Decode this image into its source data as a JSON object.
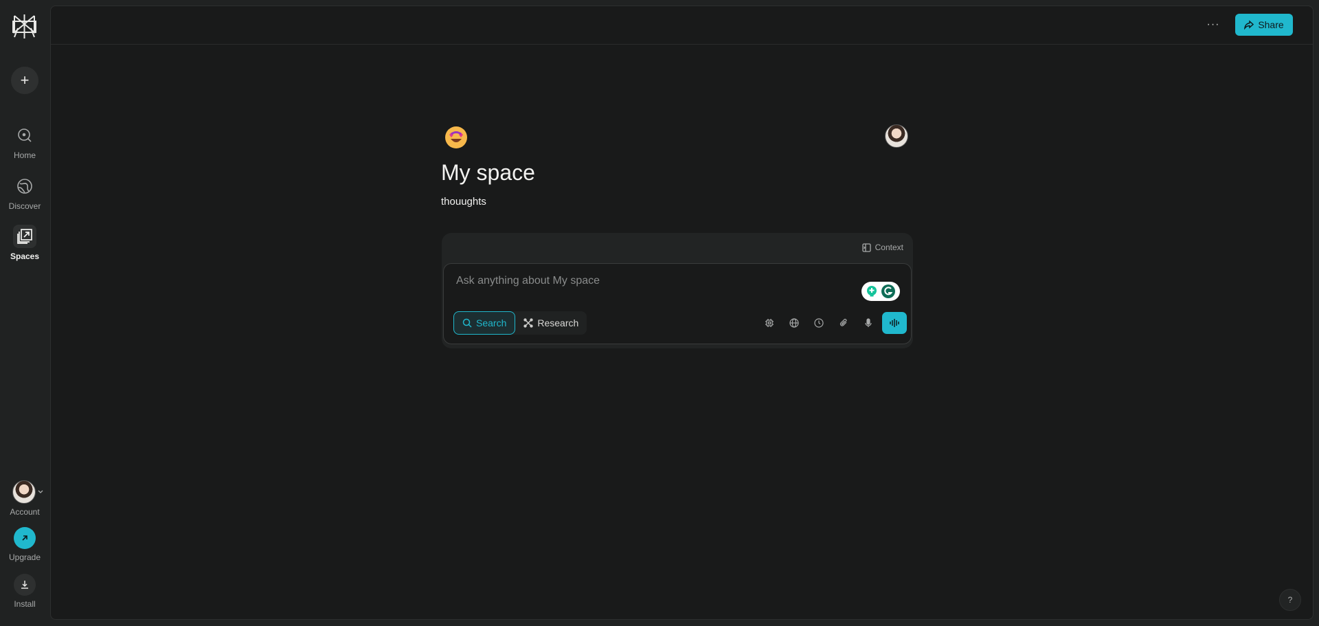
{
  "sidebar": {
    "new_thread_label": "+",
    "items": [
      {
        "label": "Home",
        "icon": "home-search-icon"
      },
      {
        "label": "Discover",
        "icon": "globe-icon"
      },
      {
        "label": "Spaces",
        "icon": "spaces-icon"
      }
    ],
    "account_label": "Account",
    "upgrade_label": "Upgrade",
    "install_label": "Install"
  },
  "header": {
    "more_label": "···",
    "share_label": "Share"
  },
  "space": {
    "emoji": "🤩",
    "title": "My space",
    "description": "thouughts",
    "context_label": "Context",
    "input_placeholder": "Ask anything about My space",
    "modes": [
      {
        "label": "Search",
        "active": true
      },
      {
        "label": "Research",
        "active": false
      }
    ],
    "tools": [
      "model-chip-icon",
      "globe-icon",
      "clock-icon",
      "paperclip-icon",
      "microphone-icon"
    ],
    "voice_icon": "voice-wave-icon"
  },
  "help_label": "?",
  "colors": {
    "accent": "#20b8cd",
    "background": "#191a1a",
    "sidebar": "#202222"
  }
}
